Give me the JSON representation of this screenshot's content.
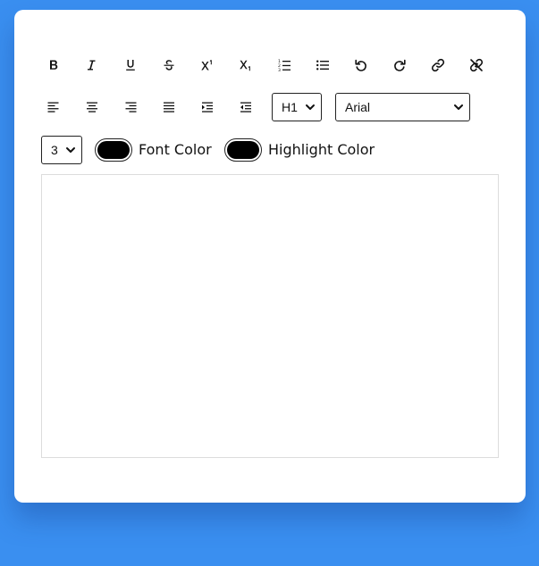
{
  "colors": {
    "background": "#3a8ff0",
    "card": "#ffffff",
    "swatch": "#000000"
  },
  "toolbar": {
    "format_buttons": [
      {
        "name": "bold",
        "icon": "bold-icon"
      },
      {
        "name": "italic",
        "icon": "italic-icon"
      },
      {
        "name": "underline",
        "icon": "underline-icon"
      },
      {
        "name": "strikethrough",
        "icon": "strikethrough-icon"
      },
      {
        "name": "superscript",
        "icon": "superscript-icon"
      },
      {
        "name": "subscript",
        "icon": "subscript-icon"
      },
      {
        "name": "ordered-list",
        "icon": "ordered-list-icon"
      },
      {
        "name": "unordered-list",
        "icon": "unordered-list-icon"
      },
      {
        "name": "undo",
        "icon": "undo-icon"
      },
      {
        "name": "redo",
        "icon": "redo-icon"
      },
      {
        "name": "link",
        "icon": "link-icon"
      },
      {
        "name": "unlink",
        "icon": "unlink-icon"
      }
    ],
    "align_buttons": [
      {
        "name": "align-left",
        "icon": "align-left-icon"
      },
      {
        "name": "align-center",
        "icon": "align-center-icon"
      },
      {
        "name": "align-right",
        "icon": "align-right-icon"
      },
      {
        "name": "align-justify",
        "icon": "align-justify-icon"
      },
      {
        "name": "indent",
        "icon": "indent-icon"
      },
      {
        "name": "outdent",
        "icon": "outdent-icon"
      }
    ],
    "heading_select": {
      "value": "H1"
    },
    "font_select": {
      "value": "Arial"
    },
    "size_select": {
      "value": "3"
    },
    "font_color": {
      "label": "Font Color",
      "value": "#000000"
    },
    "highlight_color": {
      "label": "Highlight Color",
      "value": "#000000"
    }
  },
  "editor": {
    "content": ""
  }
}
